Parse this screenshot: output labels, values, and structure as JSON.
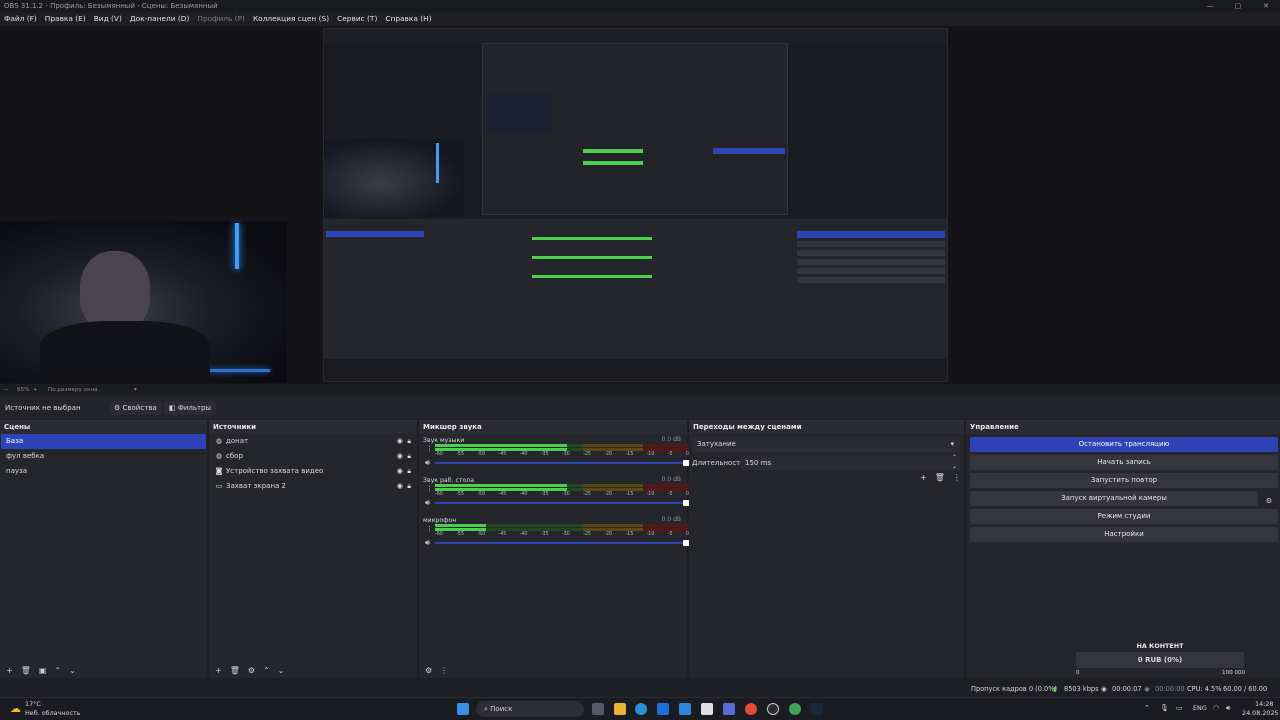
{
  "window": {
    "title": "OBS 31.1.2 - Профиль: Безымянный - Сцены: Безымянный",
    "controls": [
      "—",
      "▢",
      "✕"
    ]
  },
  "menu": [
    {
      "label": "Файл (F)",
      "enabled": true
    },
    {
      "label": "Правка (E)",
      "enabled": true
    },
    {
      "label": "Вид (V)",
      "enabled": true
    },
    {
      "label": "Док-панели (D)",
      "enabled": true
    },
    {
      "label": "Профиль (P)",
      "enabled": false
    },
    {
      "label": "Коллекция сцен (S)",
      "enabled": true
    },
    {
      "label": "Сервис (T)",
      "enabled": true
    },
    {
      "label": "Справка (H)",
      "enabled": true
    }
  ],
  "zoom": {
    "percent": "65%",
    "mode": "По размеру окна"
  },
  "source_bar": {
    "status": "Источник не выбран",
    "properties": "Свойства",
    "filters": "Фильтры"
  },
  "scenes": {
    "title": "Сцены",
    "items": [
      {
        "label": "База",
        "selected": true
      },
      {
        "label": "фул вебка",
        "selected": false
      },
      {
        "label": "пауза",
        "selected": false
      }
    ]
  },
  "sources": {
    "title": "Источники",
    "items": [
      {
        "label": "донат",
        "icon": "globe-icon"
      },
      {
        "label": "сбор",
        "icon": "globe-icon"
      },
      {
        "label": "Устройство захвата видео",
        "icon": "camera-icon"
      },
      {
        "label": "Захват экрана 2",
        "icon": "monitor-icon"
      }
    ]
  },
  "mixer": {
    "title": "Микшер звука",
    "scale": [
      "-60",
      "-55",
      "-50",
      "-45",
      "-40",
      "-35",
      "-30",
      "-25",
      "-20",
      "-15",
      "-10",
      "-5",
      "0"
    ],
    "channels": [
      {
        "name": "Звук музыки",
        "db": "0.0 dB",
        "level": 0.52
      },
      {
        "name": "Звук раб. стола",
        "db": "0.0 dB",
        "level": 0.52
      },
      {
        "name": "микрофон",
        "db": "0.0 dB",
        "level": 0.2
      }
    ]
  },
  "transitions": {
    "title": "Переходы между сценами",
    "selected": "Затухание",
    "duration_label": "Длительность",
    "duration_value": "150 ms"
  },
  "controls": {
    "title": "Управление",
    "buttons": [
      "Остановить трансляцию",
      "Начать запись",
      "Запустить повтор",
      "Запуск виртуальной камеры",
      "Режим студии",
      "Настройки"
    ]
  },
  "donation": {
    "title": "НА КОНТЕНТ",
    "amount": "0 RUB (0%)",
    "min": "0",
    "max": "100 000",
    "progress": 0
  },
  "status": {
    "dropped": "Пропуск кадров 0 (0.0%)",
    "bitrate": "8503 kbps",
    "stream_time": "00:00:07",
    "rec_time": "00:00:00",
    "cpu": "CPU: 4.5%",
    "fps": "60.00 / 60.00 FPS"
  },
  "taskbar": {
    "weather_temp": "17°C",
    "weather_desc": "Неб. облачность",
    "search": "Поиск",
    "lang": "ENG",
    "time": "14:28",
    "date": "24.08.2025"
  },
  "colors": {
    "accent": "#2d44b7",
    "panel": "#25262c",
    "meter_green": "#4cd04c",
    "meter_yellow": "#c9a51a",
    "meter_red": "#b32525"
  }
}
